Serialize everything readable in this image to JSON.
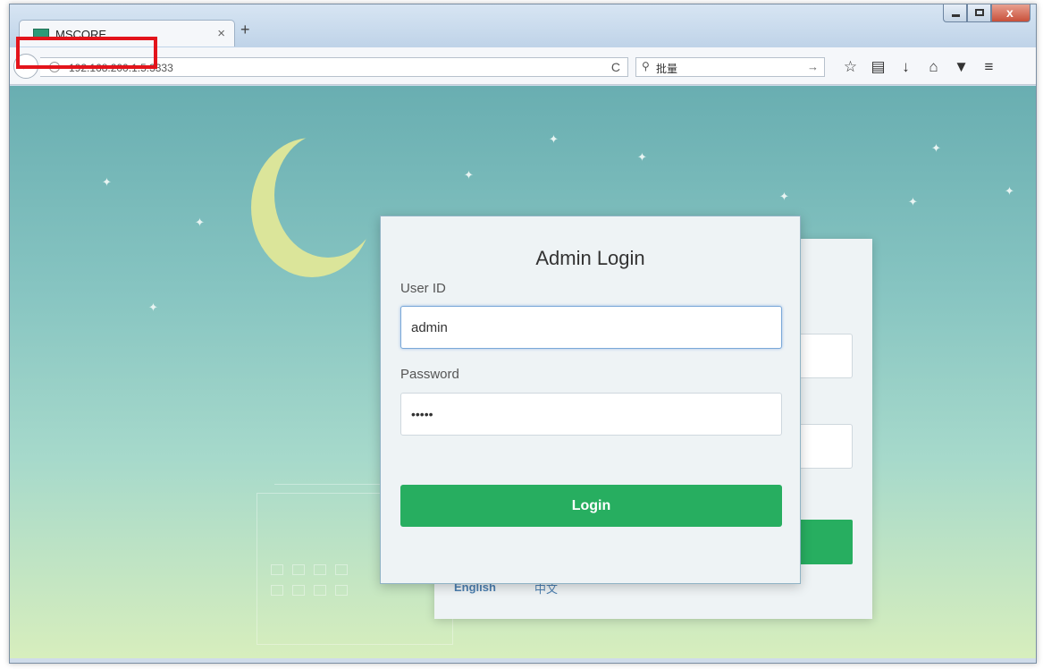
{
  "browser": {
    "tab_title": "MSCORE",
    "tab_close": "×",
    "new_tab": "+",
    "url": "192.168.200.1:5:3333",
    "reload": "C",
    "search_query": "批量",
    "search_go": "→",
    "window_controls": {
      "close": "x"
    }
  },
  "login": {
    "title": "Admin Login",
    "user_label": "User ID",
    "user_value": "admin",
    "password_label": "Password",
    "password_value": "•••••",
    "button_label": "Login"
  },
  "background_card": {
    "lang_english": "English",
    "lang_chinese": "中文"
  },
  "colors": {
    "accent": "#27ae60",
    "highlight": "#e3141b"
  },
  "icons": [
    "favicon-icon",
    "back-icon",
    "info-icon",
    "reload-icon",
    "search-icon",
    "bookmark-star-icon",
    "reading-list-icon",
    "download-icon",
    "home-icon",
    "pocket-icon",
    "menu-icon",
    "moon-icon",
    "star-icon"
  ]
}
